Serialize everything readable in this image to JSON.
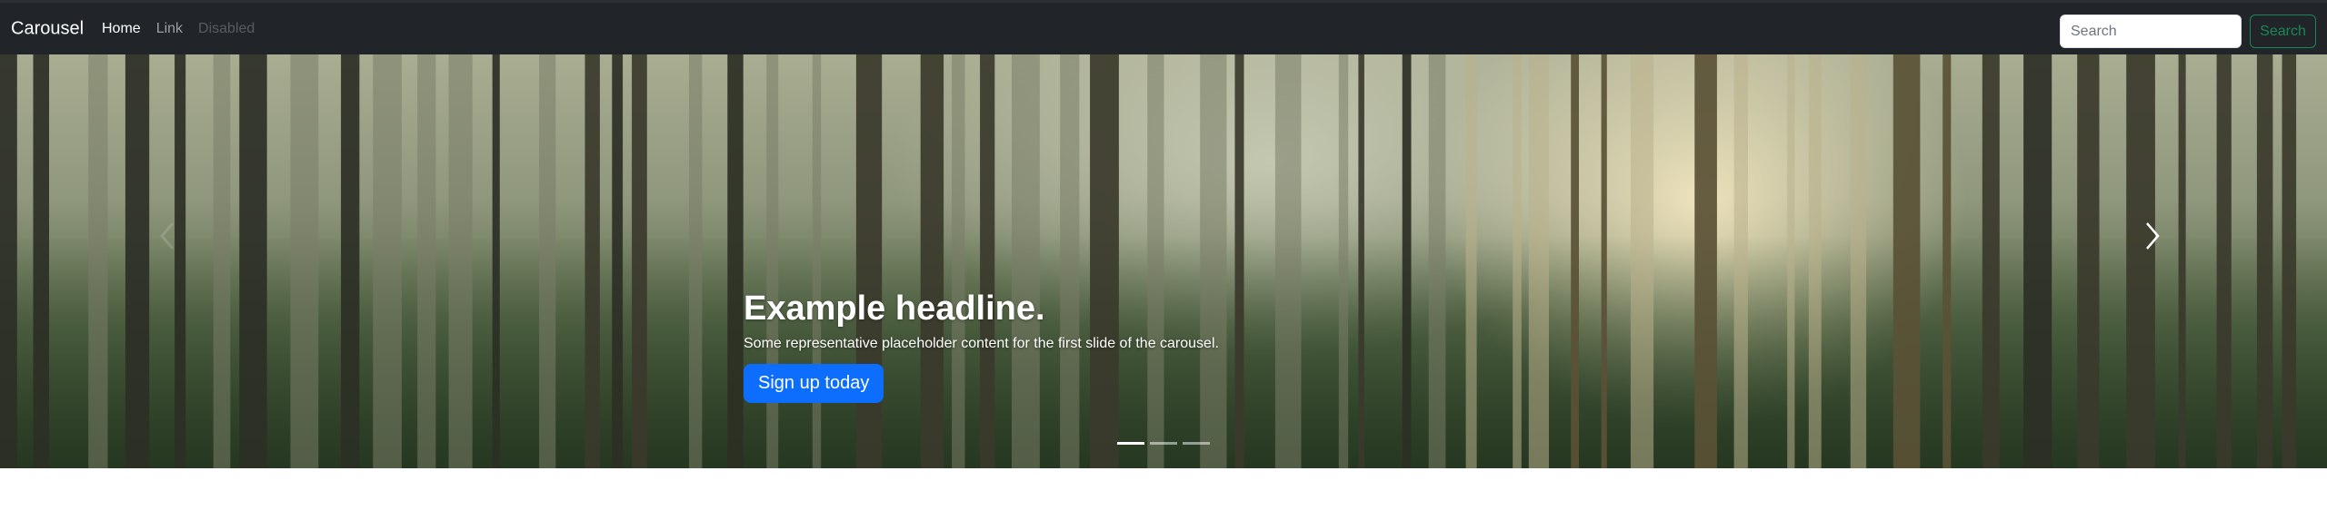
{
  "navbar": {
    "brand": "Carousel",
    "links": [
      {
        "label": "Home",
        "state": "active"
      },
      {
        "label": "Link",
        "state": "normal"
      },
      {
        "label": "Disabled",
        "state": "disabled"
      }
    ],
    "search": {
      "placeholder": "Search",
      "button_label": "Search"
    }
  },
  "carousel": {
    "slides_count": 3,
    "active_index": 0,
    "caption": {
      "heading": "Example headline.",
      "text": "Some representative placeholder content for the first slide of the carousel.",
      "button_label": "Sign up today"
    },
    "controls": {
      "prev_icon": "chevron-left-icon",
      "next_icon": "chevron-right-icon"
    }
  },
  "colors": {
    "navbar_bg": "#212529",
    "primary": "#0d6efd",
    "success": "#198754"
  }
}
